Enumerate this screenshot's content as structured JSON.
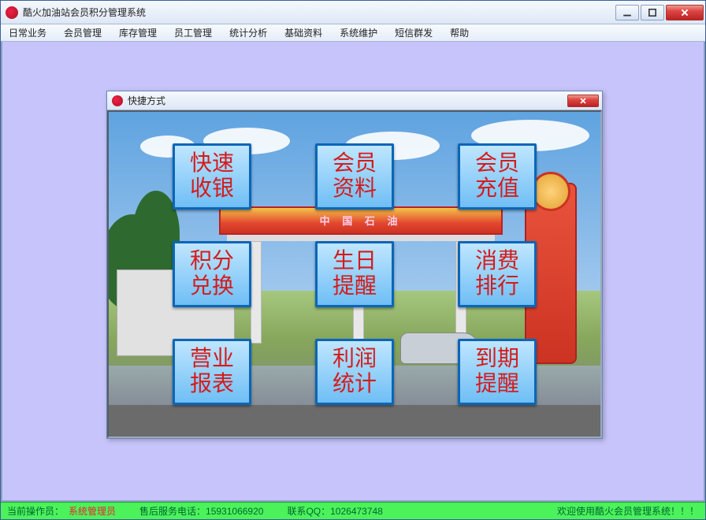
{
  "window": {
    "title": "酷火加油站会员积分管理系统"
  },
  "menu": {
    "items": [
      "日常业务",
      "会员管理",
      "库存管理",
      "员工管理",
      "统计分析",
      "基础资料",
      "系统维护",
      "短信群发",
      "帮助"
    ]
  },
  "modal": {
    "title": "快捷方式",
    "canopy_text": "中 国 石 油",
    "shortcuts": [
      "快速收银",
      "会员资料",
      "会员充值",
      "积分兑换",
      "生日提醒",
      "消费排行",
      "营业报表",
      "利润统计",
      "到期提醒"
    ]
  },
  "status": {
    "operator_label": "当前操作员：",
    "operator_name": "系统管理员",
    "service_phone": "售后服务电话：15931066920",
    "contact_qq": "联系QQ：1026473748",
    "welcome": "欢迎使用酷火会员管理系统！！！"
  }
}
